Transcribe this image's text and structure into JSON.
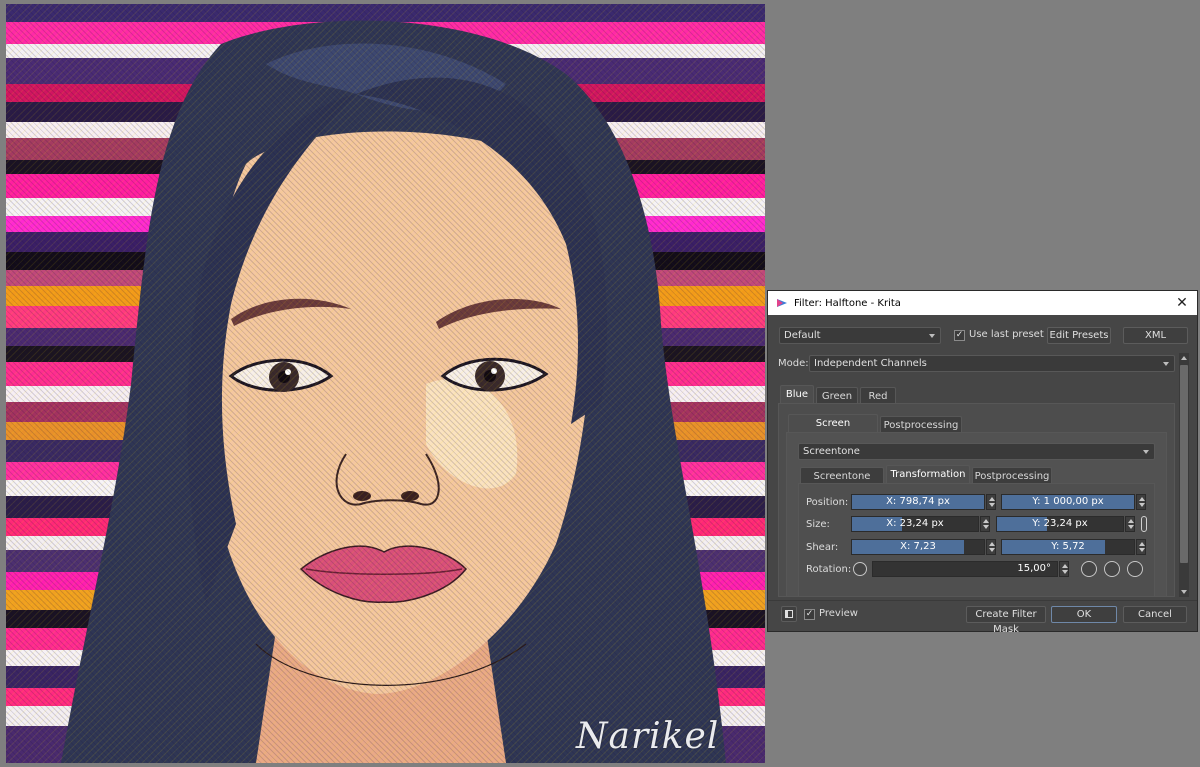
{
  "canvas": {
    "signature": "Narikel"
  },
  "dialog": {
    "title": "Filter: Halftone - Krita",
    "preset": "Default",
    "use_last_preset_label": "Use last preset",
    "use_last_preset_checked": true,
    "edit_presets_label": "Edit Presets",
    "xml_label": "XML",
    "mode_label": "Mode:",
    "mode_value": "Independent Channels",
    "channel_tabs": [
      "Blue",
      "Green",
      "Red"
    ],
    "active_channel_tab": "Blue",
    "sub_tabs": [
      "Screen Generator",
      "Postprocessing"
    ],
    "generator_value": "Screentone",
    "screentone_tabs": [
      "Screentone Type",
      "Transformation",
      "Postprocessing"
    ],
    "active_screentone_tab": "Transformation",
    "position_label": "Position:",
    "position_x": "X: 798,74 px",
    "position_y": "Y: 1 000,00 px",
    "size_label": "Size:",
    "size_x": "X: 23,24 px",
    "size_y": "Y: 23,24 px",
    "shear_label": "Shear:",
    "shear_x": "X: 7,23",
    "shear_y": "Y: 5,72",
    "rotation_label": "Rotation:",
    "rotation_value": "15,00°",
    "preview_label": "Preview",
    "preview_checked": true,
    "create_filter_mask_label": "Create Filter Mask",
    "ok_label": "OK",
    "cancel_label": "Cancel",
    "accent_color": "#4e6f9a"
  }
}
